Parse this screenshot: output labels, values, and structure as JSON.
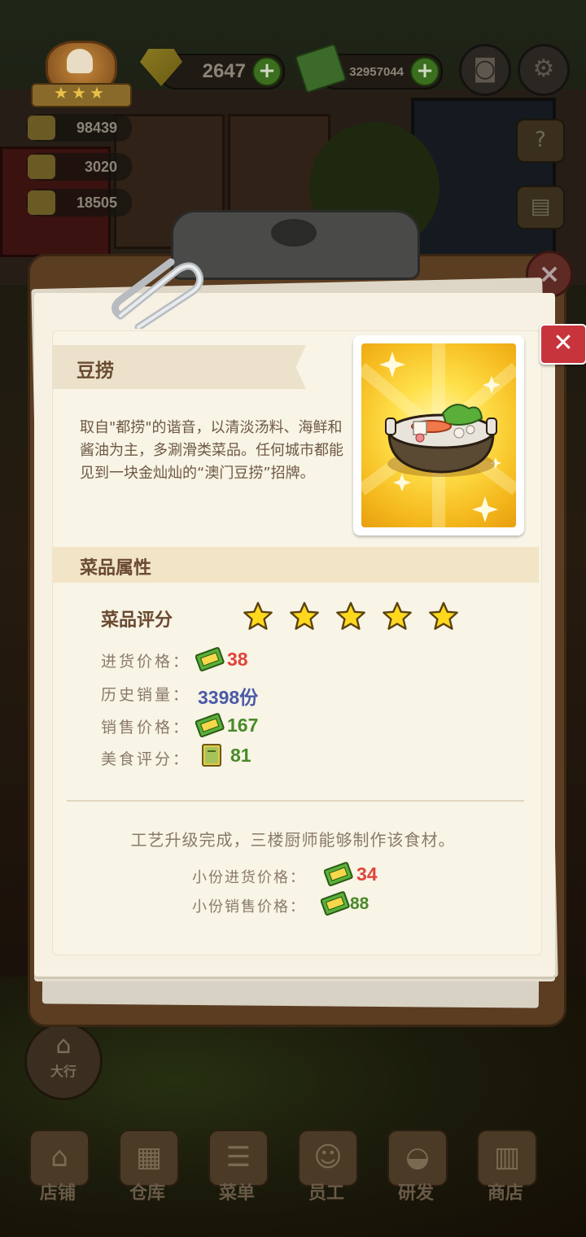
{
  "hud": {
    "gems": "2647",
    "cash": "32957044",
    "stats": [
      "98439",
      "3020",
      "18505"
    ]
  },
  "dish": {
    "name": "豆捞",
    "description": "取自\"都捞\"的谐音，以清淡汤料、海鲜和酱油为主，多涮滑类菜品。任何城市都能见到一块金灿灿的“澳门豆捞”招牌。",
    "section_title": "菜品属性",
    "rating_label": "菜品评分",
    "rating_stars": 5,
    "rating_max": 5,
    "purchase_price_label": "进货价格：",
    "purchase_price": "38",
    "sales_history_label": "历史销量：",
    "sales_history": "3398份",
    "sale_price_label": "销售价格：",
    "sale_price": "167",
    "food_score_label": "美食评分：",
    "food_score": "81",
    "upgrade_note": "工艺升级完成，三楼厨师能够制作该食材。",
    "small_purchase_label": "小份进货价格：",
    "small_purchase_price": "34",
    "small_sale_label": "小份销售价格：",
    "small_sale_price": "88"
  },
  "nav": {
    "hall": "大行",
    "items": [
      "店铺",
      "仓库",
      "菜单",
      "员工",
      "研发",
      "商店"
    ]
  },
  "colors": {
    "price_red": "#e0443a",
    "sales_blue": "#4a5aa8",
    "price_green": "#4a8a2a",
    "close_red": "#c8343c",
    "card_yellow": "#ffe04a"
  }
}
